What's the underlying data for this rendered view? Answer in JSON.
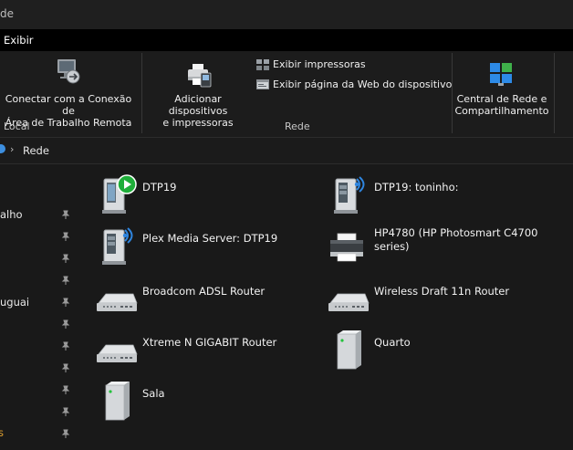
{
  "window": {
    "title_fragment": "de"
  },
  "menu": {
    "tab_view": "Exibir"
  },
  "ribbon": {
    "remote_desktop_line1": "Conectar com a Conexão de",
    "remote_desktop_line2": "Área de Trabalho Remota",
    "group_local": "Local",
    "add_devices_line1": "Adicionar dispositivos",
    "add_devices_line2": "e impressoras",
    "view_printers": "Exibir impressoras",
    "view_device_webpage": "Exibir página da Web do dispositivo",
    "group_network": "Rede",
    "network_center_line1": "Central de Rede e",
    "network_center_line2": "Compartilhamento"
  },
  "address": {
    "location": "Rede"
  },
  "sidebar": {
    "items": [
      {
        "text": "alho"
      },
      {
        "text": "uguai"
      },
      {
        "text": "s"
      }
    ]
  },
  "devices": [
    {
      "name": "DTP19",
      "icon": "media-player-icon"
    },
    {
      "name": "DTP19: toninho:",
      "icon": "media-server-icon"
    },
    {
      "name": "Plex Media Server: DTP19",
      "icon": "media-server-icon"
    },
    {
      "name": "HP4780 (HP Photosmart C4700",
      "name2": "series)",
      "icon": "printer-icon"
    },
    {
      "name": "Broadcom ADSL Router",
      "icon": "router-icon"
    },
    {
      "name": "Wireless Draft 11n Router",
      "icon": "router-icon"
    },
    {
      "name": "Xtreme N GIGABIT Router",
      "icon": "router-icon"
    },
    {
      "name": "Quarto",
      "icon": "computer-tower-icon"
    },
    {
      "name": "Sala",
      "icon": "computer-tower-icon"
    }
  ],
  "colors": {
    "menubar": "#000000",
    "ribbon": "#1c1c1c",
    "background": "#191919",
    "play_accent": "#1fae3a",
    "wave_accent": "#2f86e0"
  }
}
